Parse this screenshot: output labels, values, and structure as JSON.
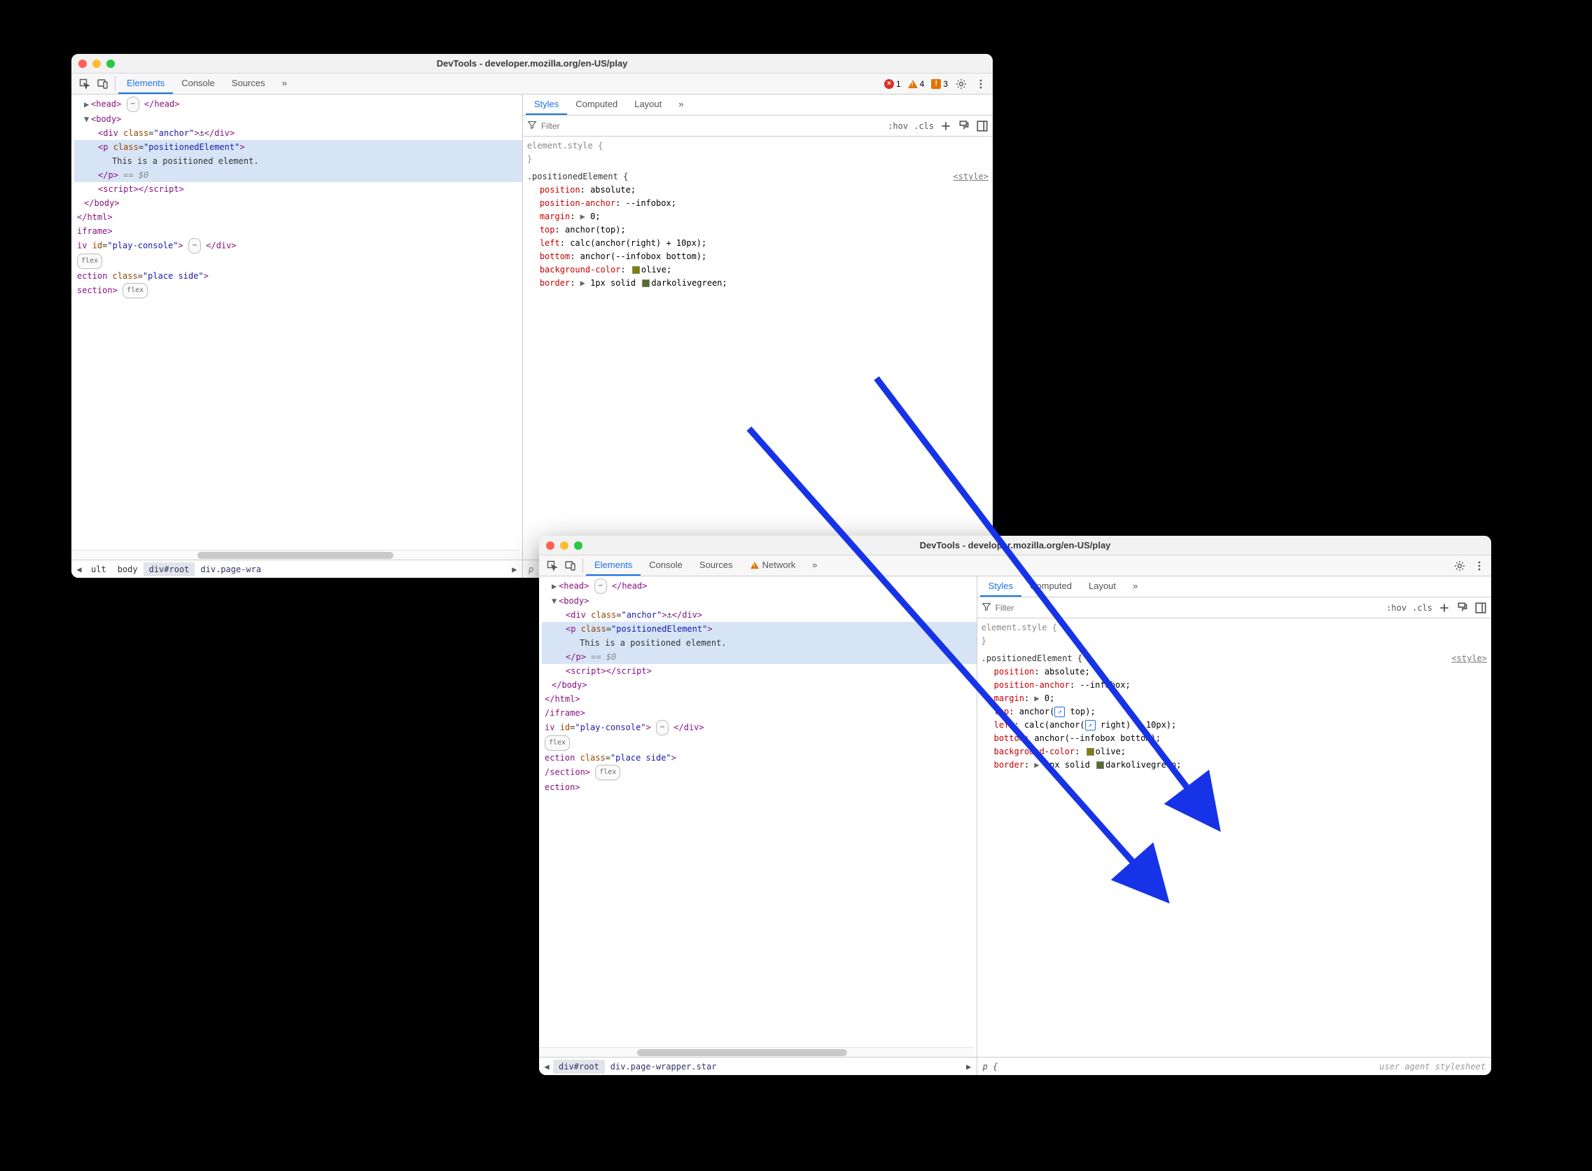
{
  "window1": {
    "title": "DevTools - developer.mozilla.org/en-US/play",
    "tabs": {
      "elements": "Elements",
      "console": "Console",
      "sources": "Sources"
    },
    "issue_counts": {
      "errors": "1",
      "warnings": "4",
      "violations": "3"
    },
    "dom": {
      "head": "<head>…</head>",
      "body_o": "<body>",
      "div_anchor_open": "<div class=\"anchor\">",
      "div_anchor_glyph": "⚓",
      "div_close": "</div>",
      "p_open": "<p class=\"positionedElement\">",
      "p_text": "This is a positioned element.",
      "p_close": "</p>",
      "eq0": "== $0",
      "script": "<script></script>",
      "body_c": "</body>",
      "html_c": "</html>",
      "iframe_c": "iframe>",
      "play": "iv id=\"play-console\">…</div>",
      "flex": "flex",
      "section": "ection class=\"place side\">",
      "section2": "section>"
    },
    "breadcrumb": [
      "ult",
      "body",
      "div#root",
      "div.page-wra"
    ],
    "styles": {
      "subtabs": {
        "styles": "Styles",
        "computed": "Computed",
        "layout": "Layout"
      },
      "filter_placeholder": "Filter",
      "hov": ":hov",
      "cls": ".cls",
      "element_style_label": "element.style {",
      "selector": ".positionedElement {",
      "source": "<style>",
      "rules": {
        "position_name": "position",
        "position_val": "absolute",
        "positionanchor_name": "position-anchor",
        "positionanchor_val": "--infobox",
        "margin_name": "margin",
        "margin_val": "0",
        "top_name": "top",
        "top_val": "anchor(top)",
        "left_name": "left",
        "left_val": "calc(anchor(right) + 10px)",
        "bottom_name": "bottom",
        "bottom_val": "anchor(--infobox bottom)",
        "bg_name": "background-color",
        "bg_val": "olive",
        "bg_swatch": "#808000",
        "border_name": "border",
        "border_val": "1px solid",
        "border_color": "darkolivegreen",
        "border_swatch": "#556b2f"
      },
      "p_label": "p"
    }
  },
  "window2": {
    "title": "DevTools - developer.mozilla.org/en-US/play",
    "tabs": {
      "elements": "Elements",
      "console": "Console",
      "sources": "Sources",
      "network": "Network"
    },
    "dom": {
      "head": "<head>…</head>",
      "body_o": "<body>",
      "div_anchor_open": "<div class=\"anchor\">",
      "div_anchor_glyph": "⚓",
      "div_close": "</div>",
      "p_open": "<p class=\"positionedElement\">",
      "p_text": "This is a positioned element.",
      "p_close": "</p>",
      "eq0": "== $0",
      "script": "<script></script>",
      "body_c": "</body>",
      "html_c": "</html>",
      "iframe_c": "/iframe>",
      "play": "iv id=\"play-console\">…</div>",
      "flex": "flex",
      "section": "ection class=\"place side\">",
      "section2_close": "/section>",
      "section3": "ection>"
    },
    "breadcrumb": [
      "div#root",
      "div.page-wrapper.star"
    ],
    "styles": {
      "subtabs": {
        "styles": "Styles",
        "computed": "Computed",
        "layout": "Layout"
      },
      "filter_placeholder": "Filter",
      "hov": ":hov",
      "cls": ".cls",
      "element_style_label": "element.style {",
      "selector": ".positionedElement {",
      "source": "<style>",
      "rules": {
        "position_name": "position",
        "position_val": "absolute",
        "positionanchor_name": "position-anchor",
        "positionanchor_val": "--infobox",
        "margin_name": "margin",
        "margin_val": "0",
        "top_name": "top",
        "top_val_pre": "anchor(",
        "top_val_post": " top)",
        "left_name": "left",
        "left_val_pre": "calc(anchor(",
        "left_val_mid": " right) + 10px)",
        "bottom_name": "bottom",
        "bottom_val": "anchor(--infobox bottom)",
        "bg_name": "background-color",
        "bg_val": "olive",
        "bg_swatch": "#808000",
        "border_name": "border",
        "border_val": "1px solid",
        "border_color": "darkolivegreen",
        "border_swatch": "#556b2f"
      },
      "p_rule": "p {",
      "ua_label": "user agent stylesheet"
    }
  }
}
